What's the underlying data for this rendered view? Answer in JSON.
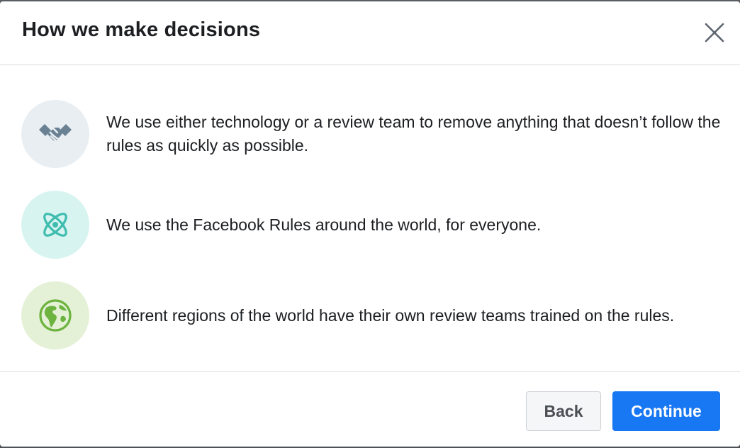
{
  "dialog": {
    "title": "How we make decisions",
    "close_icon": "close-icon"
  },
  "items": [
    {
      "icon": "handshake-icon",
      "icon_bg": "#e9eef2",
      "icon_color": "#6a8193",
      "text": "We use either technology or a review team to remove anything that doesn’t follow the rules as quickly as possible."
    },
    {
      "icon": "atom-icon",
      "icon_bg": "#d7f4f1",
      "icon_color": "#3ebcae",
      "text": "We use the Facebook Rules around the world, for everyone."
    },
    {
      "icon": "globe-icon",
      "icon_bg": "#e4f1d6",
      "icon_color": "#6cb33f",
      "text": "Different regions of the world have their own review teams trained on the rules."
    }
  ],
  "footer": {
    "back_label": "Back",
    "continue_label": "Continue"
  },
  "colors": {
    "primary": "#1877f2",
    "text": "#1c1e21",
    "divider": "#dadde1"
  }
}
